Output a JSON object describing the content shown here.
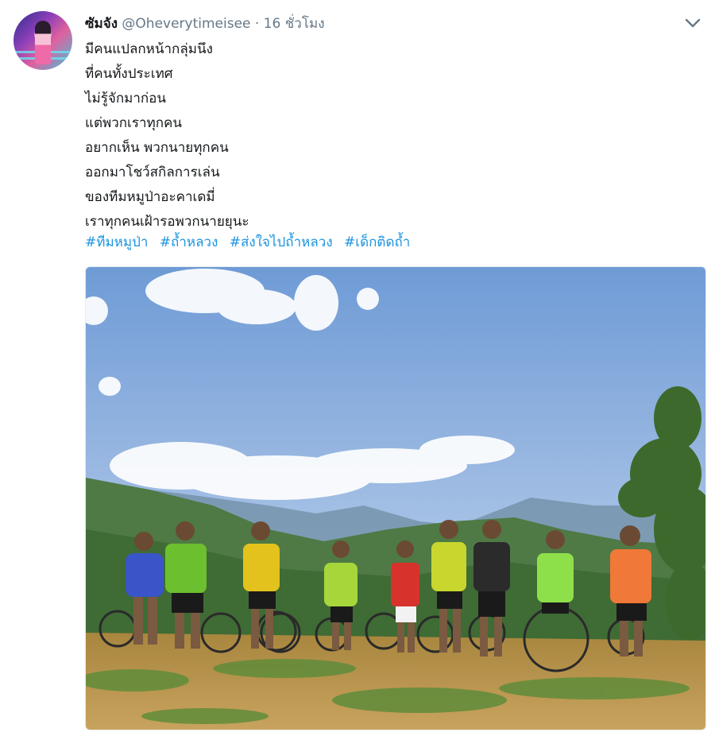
{
  "tweet": {
    "display_name": "ซัมจัง",
    "handle": "@Oheverytimeisee",
    "separator": "·",
    "time": "16 ชั่วโมง",
    "lines": [
      "มีคนแปลกหน้ากลุ่มนึง",
      "ที่คนทั้งประเทศ",
      "ไม่รู้จักมาก่อน",
      "แต่พวกเราทุกคน",
      "อยากเห็น พวกนายทุกคน",
      "ออกมาโชว์สกิลการเล่น",
      "ของทีมหมูป่าอะคาเดมี่",
      "เราทุกคนเฝ้ารอพวกนายยุนะ"
    ],
    "hashtags": [
      "#ทีมหมูป่า",
      "#ถ้ำหลวง",
      "#ส่งใจไปถ้ำหลวง",
      "#เด็กติดถ้ำ"
    ],
    "menu_icon": "chevron-down-icon",
    "link_color": "#1b95e0"
  }
}
